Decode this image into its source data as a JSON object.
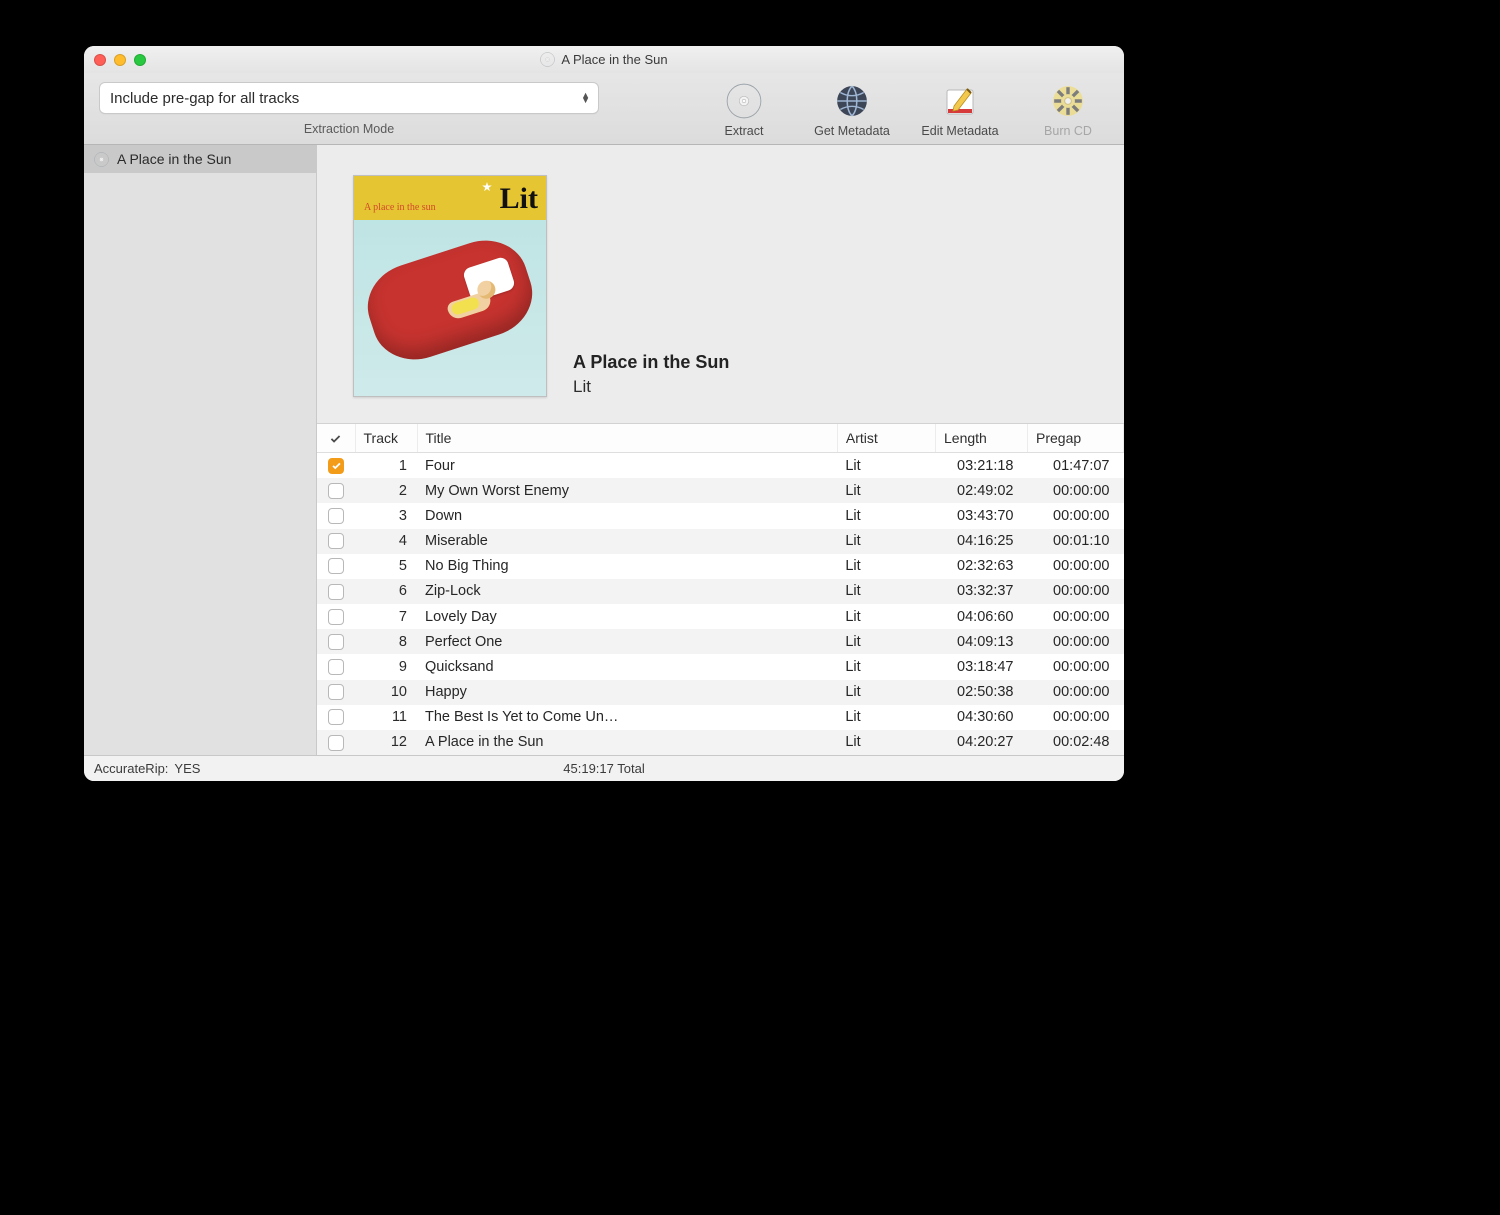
{
  "window": {
    "title": "A Place in the Sun"
  },
  "toolbar": {
    "mode_value": "Include pre-gap for all tracks",
    "mode_label": "Extraction Mode",
    "buttons": {
      "extract": "Extract",
      "get_metadata": "Get Metadata",
      "edit_metadata": "Edit Metadata",
      "burn_cd": "Burn CD"
    }
  },
  "sidebar": {
    "items": [
      {
        "label": "A Place in the Sun"
      }
    ]
  },
  "album": {
    "title": "A Place in the Sun",
    "artist": "Lit",
    "cover_logo": "Lit",
    "cover_subtitle": "A place in the sun"
  },
  "table": {
    "columns": {
      "check": "✓",
      "track": "Track",
      "title": "Title",
      "artist": "Artist",
      "length": "Length",
      "pregap": "Pregap"
    },
    "tracks": [
      {
        "n": 1,
        "title": "Four",
        "artist": "Lit",
        "length": "03:21:18",
        "pregap": "01:47:07",
        "checked": true
      },
      {
        "n": 2,
        "title": "My Own Worst Enemy",
        "artist": "Lit",
        "length": "02:49:02",
        "pregap": "00:00:00",
        "checked": false
      },
      {
        "n": 3,
        "title": "Down",
        "artist": "Lit",
        "length": "03:43:70",
        "pregap": "00:00:00",
        "checked": false
      },
      {
        "n": 4,
        "title": "Miserable",
        "artist": "Lit",
        "length": "04:16:25",
        "pregap": "00:01:10",
        "checked": false
      },
      {
        "n": 5,
        "title": "No Big Thing",
        "artist": "Lit",
        "length": "02:32:63",
        "pregap": "00:00:00",
        "checked": false
      },
      {
        "n": 6,
        "title": "Zip-Lock",
        "artist": "Lit",
        "length": "03:32:37",
        "pregap": "00:00:00",
        "checked": false
      },
      {
        "n": 7,
        "title": "Lovely Day",
        "artist": "Lit",
        "length": "04:06:60",
        "pregap": "00:00:00",
        "checked": false
      },
      {
        "n": 8,
        "title": "Perfect One",
        "artist": "Lit",
        "length": "04:09:13",
        "pregap": "00:00:00",
        "checked": false
      },
      {
        "n": 9,
        "title": "Quicksand",
        "artist": "Lit",
        "length": "03:18:47",
        "pregap": "00:00:00",
        "checked": false
      },
      {
        "n": 10,
        "title": "Happy",
        "artist": "Lit",
        "length": "02:50:38",
        "pregap": "00:00:00",
        "checked": false
      },
      {
        "n": 11,
        "title": "The Best Is Yet to Come Un…",
        "artist": "Lit",
        "length": "04:30:60",
        "pregap": "00:00:00",
        "checked": false
      },
      {
        "n": 12,
        "title": "A Place in the Sun",
        "artist": "Lit",
        "length": "04:20:27",
        "pregap": "00:02:48",
        "checked": false
      }
    ]
  },
  "status": {
    "accuraterip_label": "AccurateRip:",
    "accuraterip_value": "YES",
    "total": "45:19:17 Total"
  }
}
